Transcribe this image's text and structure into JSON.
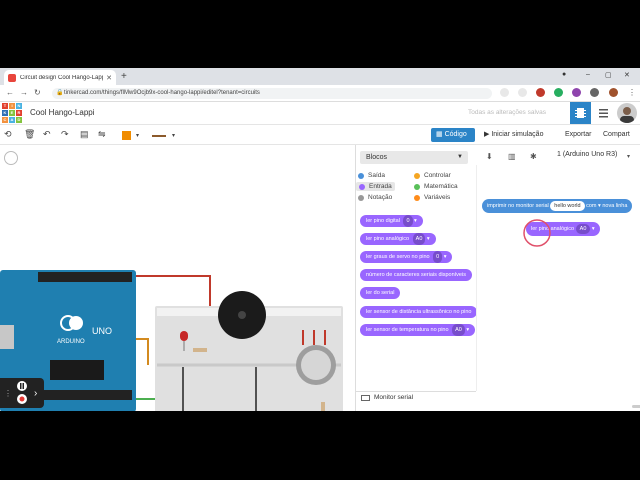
{
  "browser": {
    "tab_title": "Circuit design Cool Hango-Lappi",
    "url": "tinkercad.com/things/fIMw9Ocjb9x-cool-hango-lappi/editel?tenant=circuits"
  },
  "header": {
    "logo_letters": [
      "TIN",
      "KER",
      "CAD"
    ],
    "project_name": "Cool Hango-Lappi",
    "save_status": "Todas as alterações salvas"
  },
  "toolbar": {
    "code_label": "Código",
    "simulate_label": "Iniciar simulação",
    "export_label": "Exportar",
    "share_label": "Compart"
  },
  "code_panel": {
    "blocks_dropdown": "Blocos",
    "device_select": "1 (Arduino Uno R3)",
    "categories": [
      {
        "label": "Saída",
        "color": "#4a90d9"
      },
      {
        "label": "Controlar",
        "color": "#f5a623"
      },
      {
        "label": "Entrada",
        "color": "#9966ff"
      },
      {
        "label": "Matemática",
        "color": "#59c059"
      },
      {
        "label": "Notação",
        "color": "#999999"
      },
      {
        "label": "Variáveis",
        "color": "#ff8c1a"
      }
    ],
    "blocks": [
      {
        "text": "ler pino digital",
        "arg": "0"
      },
      {
        "text": "ler pino analógico",
        "arg": "A0"
      },
      {
        "text": "ler graus de servo no pino",
        "arg": "0"
      },
      {
        "text": "número de caracteres seriais disponíveis",
        "arg": ""
      },
      {
        "text": "ler do serial",
        "arg": ""
      },
      {
        "text": "ler sensor de distância ultrassônico no pino",
        "arg": ""
      },
      {
        "text": "ler sensor de temperatura no pino",
        "arg": "A0"
      }
    ],
    "serial_monitor": "Monitor serial",
    "workspace": {
      "print_block": "imprimir no monitor serial",
      "print_text": "hello world",
      "with_label": "com",
      "newline_label": "nova linha",
      "read_block": "ler pino analógico",
      "read_arg": "A0"
    }
  },
  "circuit": {
    "board_label": "ARDUINO",
    "board_model": "UNO"
  },
  "colors": {
    "accent": "#2b84c7",
    "input_blocks": "#9966ff",
    "output_blocks": "#4a90d9"
  }
}
